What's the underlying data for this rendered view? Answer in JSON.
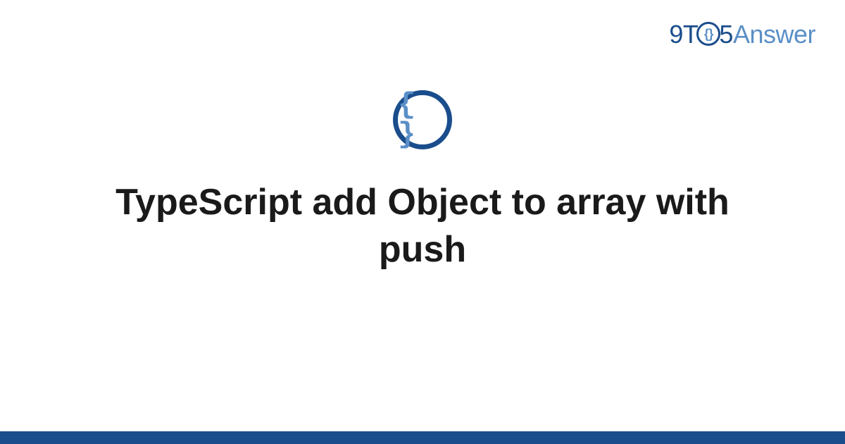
{
  "brand": {
    "prefix": "9T",
    "middle_glyph": "{}",
    "suffix": "5",
    "word": "Answer"
  },
  "icon": {
    "glyph": "{ }"
  },
  "main": {
    "title": "TypeScript add Object to array with push"
  },
  "colors": {
    "primary": "#1a4d8c",
    "accent": "#5a8fc7"
  }
}
